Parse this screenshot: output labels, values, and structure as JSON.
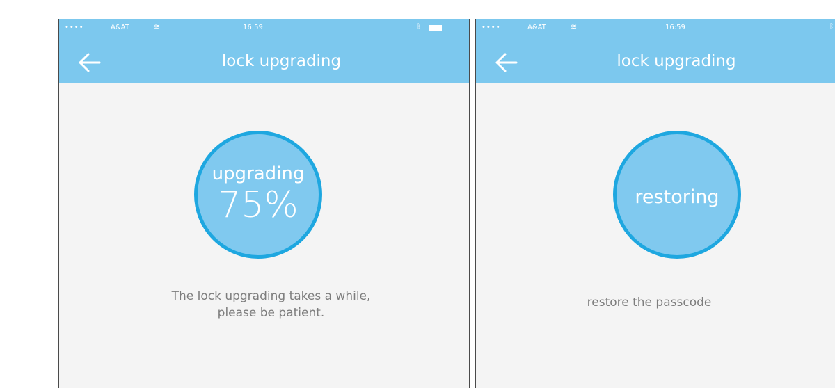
{
  "screens": [
    {
      "status_bar": {
        "signal": "••••",
        "carrier": "A&AT",
        "time": "16:59"
      },
      "title": "lock upgrading",
      "circle": {
        "line1": "upgrading",
        "line2": "75%"
      },
      "message_line1": "The lock upgrading takes a while,",
      "message_line2": "please be patient."
    },
    {
      "status_bar": {
        "signal": "••••",
        "carrier": "A&AT",
        "time": "16:59"
      },
      "title": "lock upgrading",
      "circle": {
        "text": "restoring"
      },
      "message": "restore the passcode"
    }
  ],
  "icons": {
    "back": "arrow-left-icon",
    "wifi": "wifi-icon",
    "bluetooth": "bluetooth-icon",
    "battery": "battery-icon"
  },
  "colors": {
    "header_bg": "#7cc8ee",
    "circle_fill": "#80c9ef",
    "circle_border": "#1ea7e0",
    "body_bg": "#f4f4f4",
    "message_text": "#7d7d7d"
  }
}
